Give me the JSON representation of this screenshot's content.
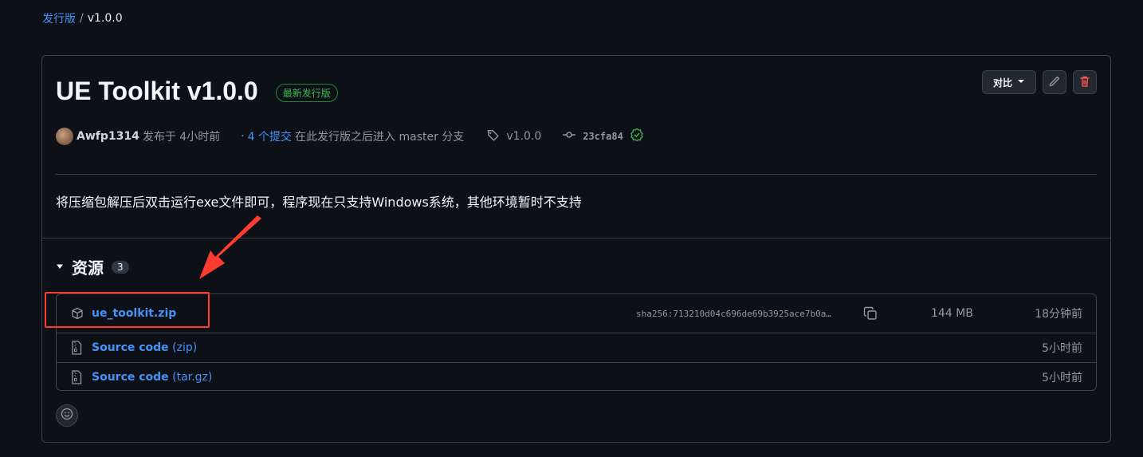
{
  "breadcrumb": {
    "parent": "发行版",
    "separator": "/",
    "current": "v1.0.0"
  },
  "release": {
    "title": "UE Toolkit v1.0.0",
    "badge": "最新发行版",
    "compare_label": "对比",
    "author": "Awfp1314",
    "published_text": "发布于 4小时前",
    "dot": "·",
    "commits_link": "4 个提交",
    "commits_suffix": "在此发行版之后进入 master 分支",
    "tag": "v1.0.0",
    "commit_sha": "23cfa84",
    "description": "将压缩包解压后双击运行exe文件即可，程序现在只支持Windows系统，其他环境暂时不支持"
  },
  "assets": {
    "title": "资源",
    "count": "3",
    "items": [
      {
        "name": "ue_toolkit.zip",
        "ext": "",
        "digest": "sha256:713210d04c696de69b3925ace7b0a…",
        "size": "144 MB",
        "time": "18分钟前"
      },
      {
        "name": "Source code",
        "ext": " (zip)",
        "time": "5小时前"
      },
      {
        "name": "Source code",
        "ext": " (tar.gz)",
        "time": "5小时前"
      }
    ]
  },
  "colors": {
    "accent": "#4493f8",
    "success": "#3fb950",
    "danger": "#f85149",
    "annotation": "#ff3b30"
  },
  "icons": [
    "caret-down-icon",
    "pencil-icon",
    "trash-icon",
    "tag-icon",
    "commit-icon",
    "verified-icon",
    "package-icon",
    "copy-icon",
    "file-zip-icon",
    "smiley-icon",
    "annotation-arrow"
  ]
}
